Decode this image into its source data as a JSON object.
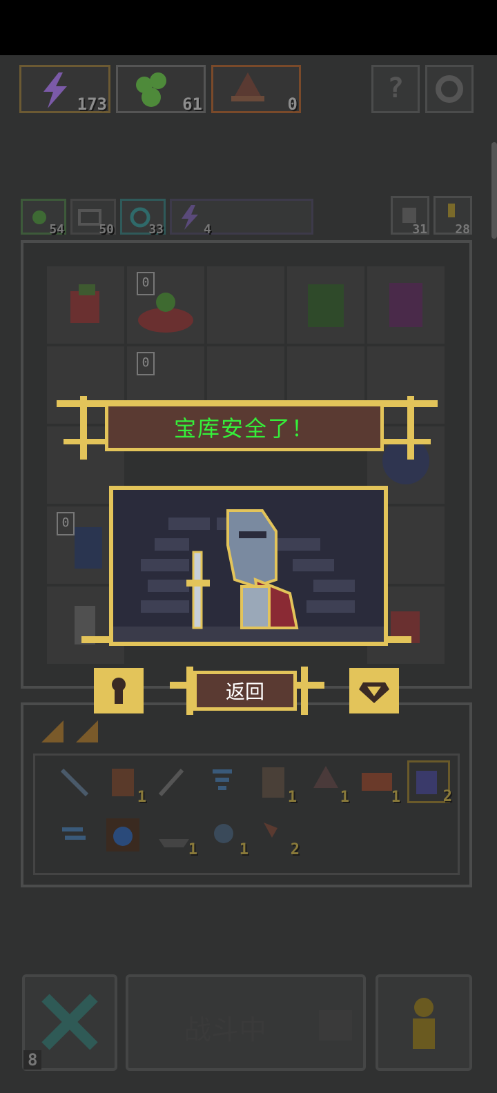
{
  "top_resources": [
    {
      "name": "energy",
      "icon": "lightning-icon",
      "count": "173"
    },
    {
      "name": "slime",
      "icon": "green-slime-icon",
      "count": "61"
    },
    {
      "name": "wizard",
      "icon": "wizard-hat-icon",
      "count": "0"
    }
  ],
  "top_buttons": {
    "help": "?",
    "settings": "gear-icon"
  },
  "mini_resources": [
    {
      "icon": "green-orb-icon",
      "count": "54"
    },
    {
      "icon": "mail-icon",
      "count": "50"
    },
    {
      "icon": "swirl-icon",
      "count": "33"
    },
    {
      "icon": "lightning-icon",
      "count": "4"
    }
  ],
  "side_counters": [
    {
      "icon": "upgrade-icon",
      "count": "31"
    },
    {
      "icon": "pawn-icon",
      "count": "28"
    }
  ],
  "board": {
    "badges": [
      "0",
      "0",
      "0"
    ]
  },
  "popup": {
    "title": "宝库安全了！",
    "back_label": "返回"
  },
  "inventory": {
    "items": [
      {
        "icon": "pickaxe-icon",
        "count": ""
      },
      {
        "icon": "barrel-icon",
        "count": "1"
      },
      {
        "icon": "dagger-icon",
        "count": ""
      },
      {
        "icon": "tornado-icon",
        "count": ""
      },
      {
        "icon": "scroll-icon",
        "count": "1"
      },
      {
        "icon": "wizard-hat-icon",
        "count": "1"
      },
      {
        "icon": "chest-icon",
        "count": "1"
      },
      {
        "icon": "potion-icon",
        "count": "2"
      },
      {
        "icon": "wind-icon",
        "count": ""
      },
      {
        "icon": "water-drop-card-icon",
        "count": ""
      },
      {
        "icon": "ship-icon",
        "count": "1"
      },
      {
        "icon": "battle-axe-icon",
        "count": "1"
      },
      {
        "icon": "axe-icon",
        "count": "2"
      }
    ]
  },
  "bottom": {
    "left_count": "8",
    "battle_label": "战斗中"
  },
  "colors": {
    "gold": "#e3c45a",
    "banner": "#5a3a32",
    "title_green": "#35f03a"
  }
}
